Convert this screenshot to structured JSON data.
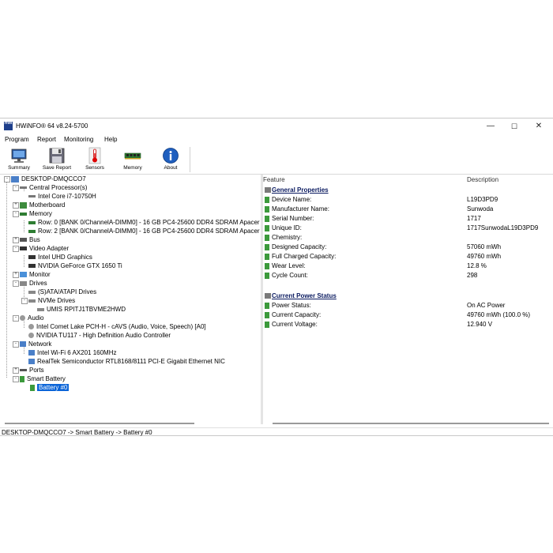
{
  "window": {
    "title": "HWiNFO® 64 v8.24-5700",
    "app_icon_text": "HWi"
  },
  "menu": [
    "Program",
    "Report",
    "Monitoring",
    "Help"
  ],
  "toolbar": {
    "summary": "Summary",
    "save_report": "Save Report",
    "sensors": "Sensors",
    "memory": "Memory",
    "about": "About"
  },
  "tree": {
    "root": "DESKTOP-DMQCCO7",
    "cpu": "Central Processor(s)",
    "cpu_item": "Intel Core i7-10750H",
    "motherboard": "Motherboard",
    "memory": "Memory",
    "mem_row0": "Row: 0 [BANK 0/ChannelA-DIMM0] - 16 GB PC4-25600 DDR4 SDRAM Apacer",
    "mem_row2": "Row: 2 [BANK 0/ChannelA-DIMM0] - 16 GB PC4-25600 DDR4 SDRAM Apacer",
    "bus": "Bus",
    "video": "Video Adapter",
    "gpu1": "Intel UHD Graphics",
    "gpu2": "NVIDIA GeForce GTX 1650 Ti",
    "monitor": "Monitor",
    "drives": "Drives",
    "sata": "(S)ATA/ATAPI Drives",
    "nvme": "NVMe Drives",
    "nvme_item": "UMIS RPITJ1TBVME2HWD",
    "audio": "Audio",
    "audio1": "Intel Comet Lake PCH-H - cAVS (Audio, Voice, Speech) [A0]",
    "audio2": "NVIDIA TU117 - High Definition Audio Controller",
    "network": "Network",
    "net1": "Intel Wi-Fi 6 AX201 160MHz",
    "net2": "RealTek Semiconductor RTL8168/8111 PCI-E Gigabit Ethernet NIC",
    "ports": "Ports",
    "smart_battery": "Smart Battery",
    "battery": "Battery #0"
  },
  "details": {
    "col_feature": "Feature",
    "col_description": "Description",
    "general_title": "General Properties",
    "general": [
      {
        "feature": "Device Name:",
        "value": "L19D3PD9"
      },
      {
        "feature": "Manufacturer Name:",
        "value": "Sunwoda"
      },
      {
        "feature": "Serial Number:",
        "value": "1717"
      },
      {
        "feature": "Unique ID:",
        "value": "1717SunwodaL19D3PD9"
      },
      {
        "feature": "Chemistry:",
        "value": ""
      },
      {
        "feature": "Designed Capacity:",
        "value": "57060 mWh"
      },
      {
        "feature": "Full Charged Capacity:",
        "value": "49760 mWh"
      },
      {
        "feature": "Wear Level:",
        "value": "12.8 %"
      },
      {
        "feature": "Cycle Count:",
        "value": "298"
      }
    ],
    "power_title": "Current Power Status",
    "power": [
      {
        "feature": "Power Status:",
        "value": "On AC Power"
      },
      {
        "feature": "Current Capacity:",
        "value": "49760 mWh (100.0 %)"
      },
      {
        "feature": "Current Voltage:",
        "value": "12.940 V"
      }
    ]
  },
  "status_bar": "DESKTOP-DMQCCO7 -> Smart Battery -> Battery #0",
  "colors": {
    "selection": "#0a64d8",
    "section_title": "#0a1a60",
    "battery_icon": "#3c9a3c"
  }
}
